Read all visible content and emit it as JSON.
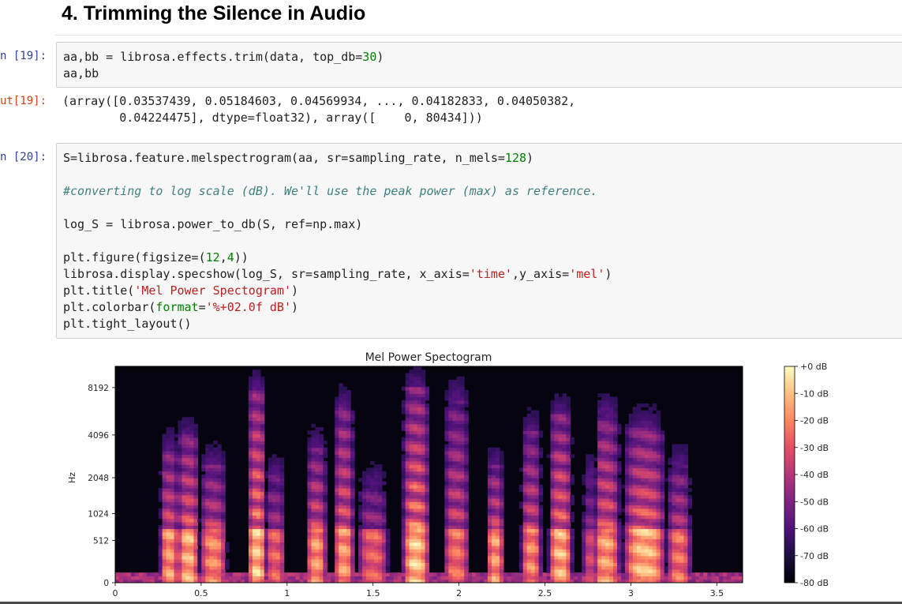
{
  "heading": "4. Trimming the Silence in Audio",
  "cells": [
    {
      "in_prompt": "n [19]:",
      "code": [
        [
          {
            "t": "aa,bb = librosa.effects.trim(data, top_db="
          },
          {
            "t": "30",
            "c": "n"
          },
          {
            "t": ")"
          }
        ],
        [
          {
            "t": "aa,bb"
          }
        ]
      ],
      "out_prompt": "ut[19]:",
      "output": [
        "(array([0.03537439, 0.05184603, 0.04569934, ..., 0.04182833, 0.04050382,",
        "        0.04224475], dtype=float32), array([    0, 80434]))"
      ]
    },
    {
      "in_prompt": "n [20]:",
      "code": [
        [
          {
            "t": "S=librosa.feature.melspectrogram(aa, sr=sampling_rate, n_mels="
          },
          {
            "t": "128",
            "c": "n"
          },
          {
            "t": ")"
          }
        ],
        [],
        [
          {
            "t": "#converting to log scale (dB). We'll use the peak power (max) as reference.",
            "c": "c"
          }
        ],
        [],
        [
          {
            "t": "log_S = librosa.power_to_db(S, ref=np.max)"
          }
        ],
        [],
        [
          {
            "t": "plt.figure(figsize=("
          },
          {
            "t": "12",
            "c": "n"
          },
          {
            "t": ","
          },
          {
            "t": "4",
            "c": "n"
          },
          {
            "t": "))"
          }
        ],
        [
          {
            "t": "librosa.display.specshow(log_S, sr=sampling_rate, x_axis="
          },
          {
            "t": "'time'",
            "c": "s"
          },
          {
            "t": ",y_axis="
          },
          {
            "t": "'mel'",
            "c": "s"
          },
          {
            "t": ")"
          }
        ],
        [
          {
            "t": "plt.title("
          },
          {
            "t": "'Mel Power Spectogram'",
            "c": "s"
          },
          {
            "t": ")"
          }
        ],
        [
          {
            "t": "plt.colorbar("
          },
          {
            "t": "format",
            "c": "kw"
          },
          {
            "t": "="
          },
          {
            "t": "'%+02.0f dB'",
            "c": "s"
          },
          {
            "t": ")"
          }
        ],
        [
          {
            "t": "plt.tight_layout()"
          }
        ]
      ]
    }
  ],
  "chart_data": {
    "type": "heatmap",
    "title": "Mel Power Spectogram",
    "xlabel": "",
    "ylabel": "Hz",
    "x_ticks": [
      "0",
      "0.5",
      "1",
      "1.5",
      "2",
      "2.5",
      "3",
      "3.5"
    ],
    "x_tick_values": [
      0,
      0.5,
      1,
      1.5,
      2,
      2.5,
      3,
      3.5
    ],
    "xlim": [
      0,
      3.65
    ],
    "y_ticks": [
      "0",
      "512",
      "1024",
      "2048",
      "4096",
      "8192"
    ],
    "y_scale": "mel",
    "colormap": "magma",
    "colorbar_ticks": [
      "+0 dB",
      "-10 dB",
      "-20 dB",
      "-30 dB",
      "-40 dB",
      "-50 dB",
      "-60 dB",
      "-70 dB",
      "-80 dB"
    ],
    "colorbar_range": [
      -80,
      0
    ],
    "syllables": [
      [
        0.27,
        0.36,
        0.85,
        0.62
      ],
      [
        0.37,
        0.48,
        0.9,
        0.68
      ],
      [
        0.5,
        0.64,
        0.8,
        0.55
      ],
      [
        0.78,
        0.87,
        0.95,
        0.9
      ],
      [
        0.88,
        0.98,
        0.7,
        0.5
      ],
      [
        1.12,
        1.22,
        0.85,
        0.62
      ],
      [
        1.28,
        1.38,
        0.85,
        0.82
      ],
      [
        1.42,
        1.58,
        0.7,
        0.45
      ],
      [
        1.68,
        1.82,
        0.95,
        0.9
      ],
      [
        1.92,
        2.05,
        0.75,
        0.85
      ],
      [
        2.17,
        2.25,
        0.85,
        0.55
      ],
      [
        2.37,
        2.47,
        0.8,
        0.7
      ],
      [
        2.53,
        2.65,
        0.9,
        0.78
      ],
      [
        2.73,
        2.8,
        0.6,
        0.5
      ],
      [
        2.78,
        2.93,
        0.85,
        0.78
      ],
      [
        2.96,
        3.2,
        0.92,
        0.72
      ],
      [
        3.22,
        3.34,
        0.75,
        0.55
      ]
    ]
  },
  "colors": {
    "in_prompt": "#303f9f",
    "out_prompt": "#d84315",
    "cell_bg": "#f7f7f7",
    "cell_border": "#cfcfcf"
  }
}
